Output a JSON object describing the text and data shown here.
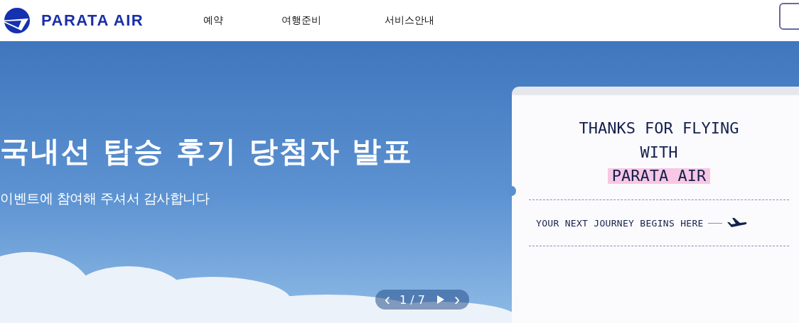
{
  "header": {
    "logo": "PARATA AIR",
    "nav": [
      {
        "label": "예약"
      },
      {
        "label": "여행준비"
      },
      {
        "label": "서비스안내"
      }
    ]
  },
  "hero": {
    "headline": "국내선 탑승 후기 당첨자 발표",
    "subtitle": "이벤트에 참여해 주셔서 감사합니다",
    "card": {
      "title_lines": [
        "THANKS FOR FLYING",
        "WITH"
      ],
      "highlight": "PARATA AIR",
      "tagline": "YOUR NEXT JOURNEY BEGINS HERE"
    },
    "pager": {
      "prev": "‹",
      "counter": "1 / 7",
      "next": "›"
    }
  }
}
